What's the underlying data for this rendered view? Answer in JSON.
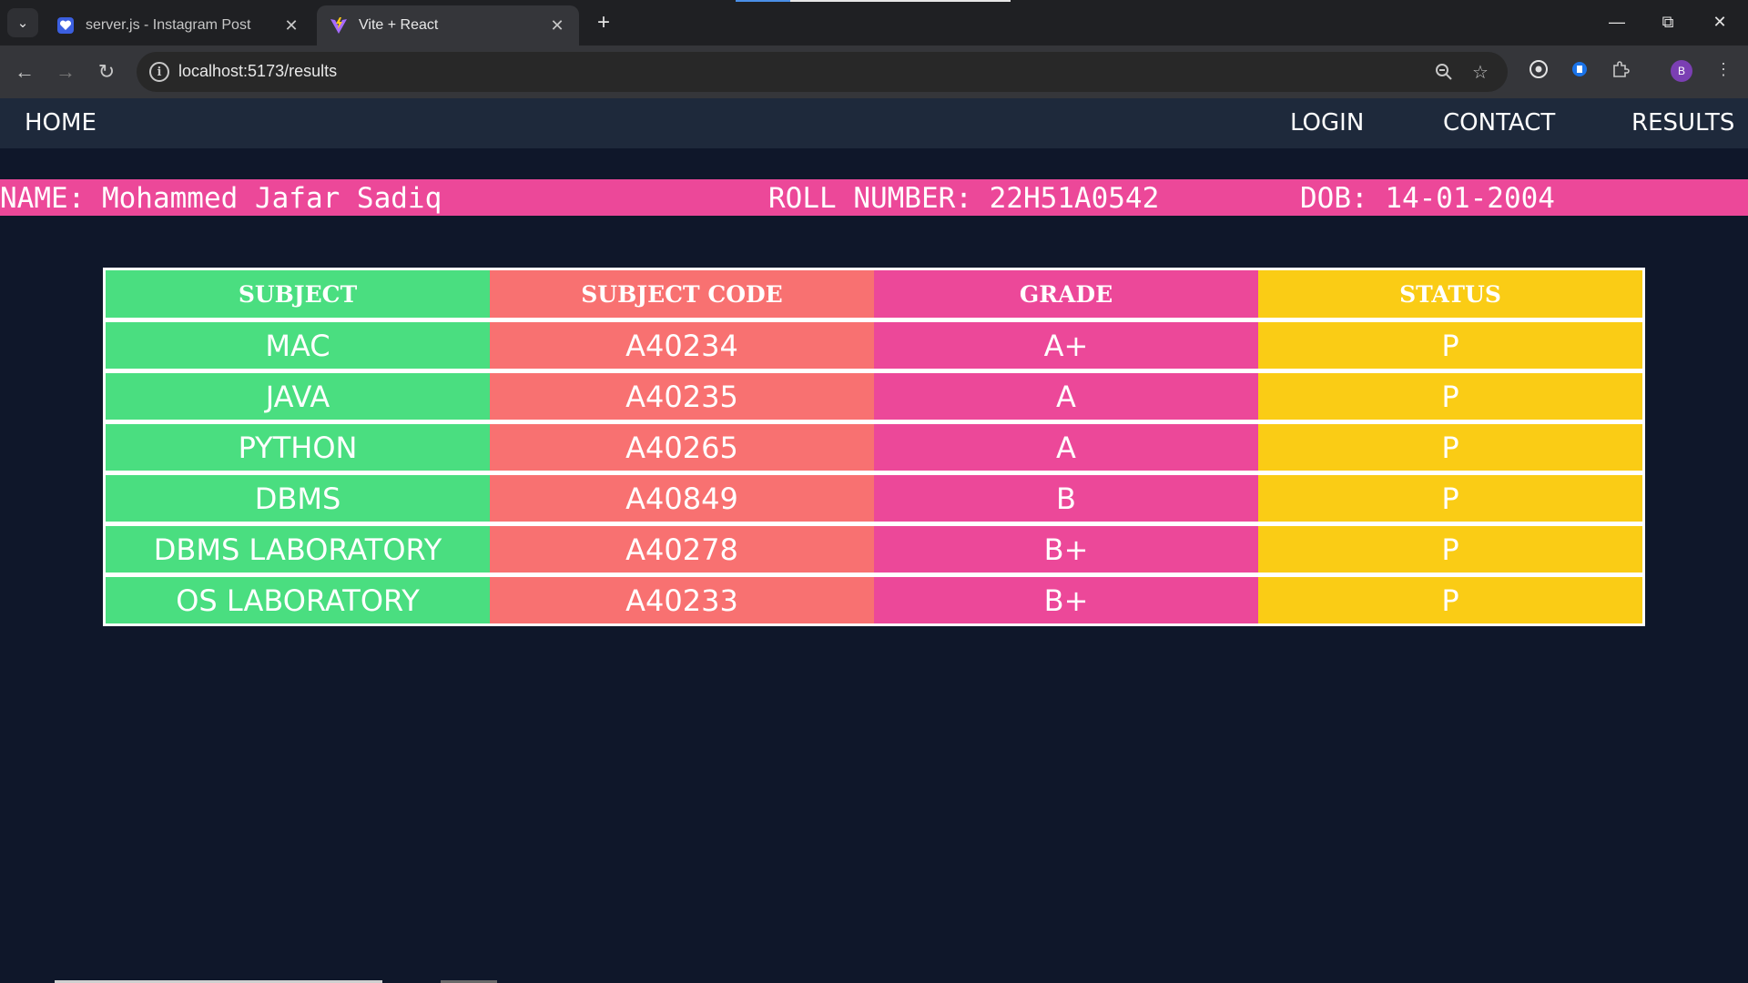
{
  "browser": {
    "tabs": [
      {
        "title": "server.js - Instagram Post",
        "active": false,
        "favicon": "heart-shield-icon"
      },
      {
        "title": "Vite + React",
        "active": true,
        "favicon": "vite-logo-icon"
      }
    ],
    "url": "localhost:5173/results",
    "profile_initial": "B"
  },
  "nav": {
    "home": "HOME",
    "login": "LOGIN",
    "contact": "CONTACT",
    "results": "RESULTS"
  },
  "student": {
    "name_text": "NAME: Mohammed Jafar Sadiq",
    "roll_text": "ROLL NUMBER: 22H51A0542",
    "dob_text": "DOB: 14-01-2004"
  },
  "table": {
    "headers": [
      "SUBJECT",
      "SUBJECT CODE",
      "GRADE",
      "STATUS"
    ],
    "rows": [
      [
        "MAC",
        "A40234",
        "A+",
        "P"
      ],
      [
        "JAVA",
        "A40235",
        "A",
        "P"
      ],
      [
        "PYTHON",
        "A40265",
        "A",
        "P"
      ],
      [
        "DBMS",
        "A40849",
        "B",
        "P"
      ],
      [
        "DBMS LABORATORY",
        "A40278",
        "B+",
        "P"
      ],
      [
        "OS LABORATORY",
        "A40233",
        "B+",
        "P"
      ]
    ]
  },
  "colors": {
    "page_bg": "#0f172a",
    "nav_bg": "#1e293b",
    "subject_col": "#4ade80",
    "code_col": "#f87171",
    "grade_col": "#ec4899",
    "status_col": "#facc15"
  }
}
